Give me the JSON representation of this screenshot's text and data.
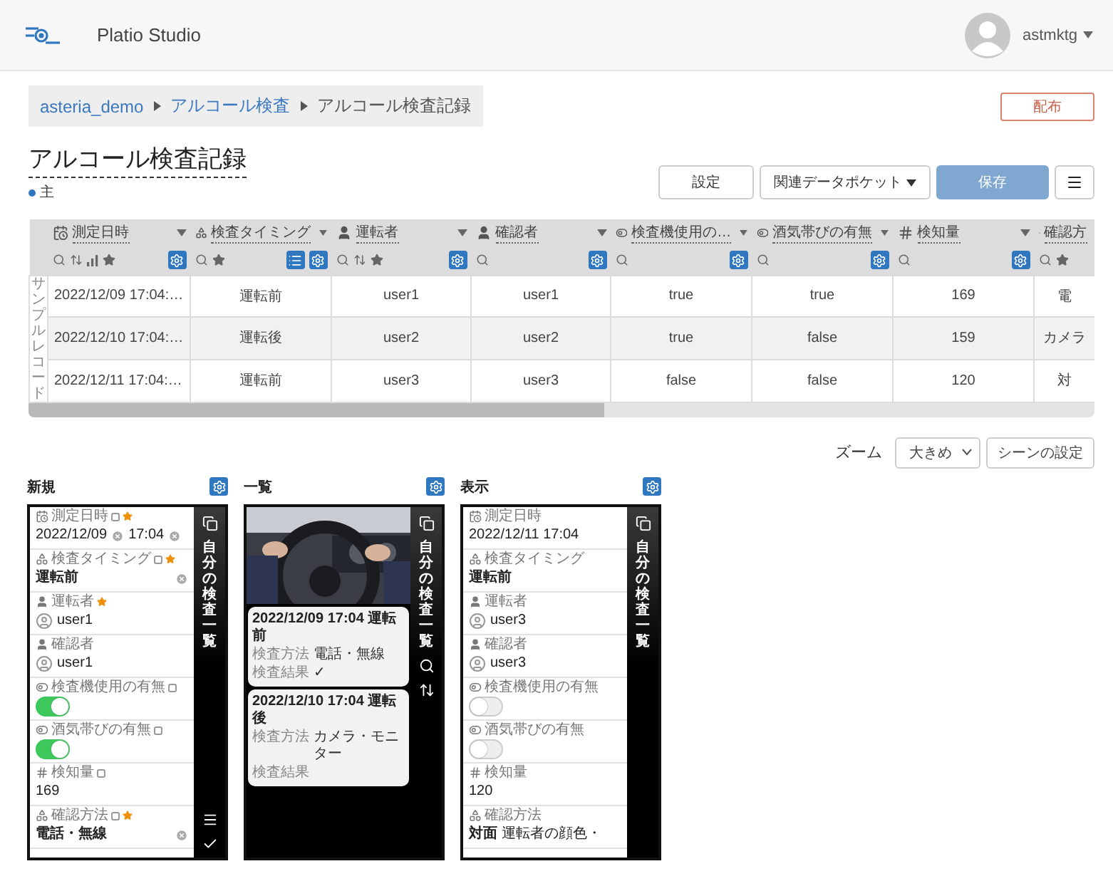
{
  "header": {
    "app_name": "Platio Studio",
    "user": "astmktg"
  },
  "breadcrumb": [
    {
      "label": "asteria_demo",
      "link": true
    },
    {
      "label": "アルコール検査",
      "link": true
    },
    {
      "label": "アルコール検査記録",
      "link": false
    }
  ],
  "publish_button": "配布",
  "page_title": "アルコール検査記録",
  "page_tag": "主",
  "toolbar": [
    {
      "label": "設定",
      "kind": "plain"
    },
    {
      "label": "関連データポケット",
      "kind": "dropdown"
    },
    {
      "label": "保存",
      "kind": "primary"
    },
    {
      "kind": "menu"
    }
  ],
  "table": {
    "side_label": "サンプルレコード",
    "columns": [
      {
        "label": "測定日時",
        "kind": "datetime",
        "sortable": true,
        "chart": true,
        "favorite": true,
        "list_button": false,
        "gear": true
      },
      {
        "label": "検査タイミング",
        "kind": "choice",
        "sortable": false,
        "chart": false,
        "favorite": true,
        "list_button": true,
        "gear": true
      },
      {
        "label": "運転者",
        "kind": "user",
        "sortable": true,
        "chart": false,
        "favorite": true,
        "list_button": false,
        "gear": true
      },
      {
        "label": "確認者",
        "kind": "user",
        "sortable": false,
        "chart": false,
        "favorite": false,
        "list_button": false,
        "gear": true
      },
      {
        "label": "検査機使用の…",
        "kind": "toggle",
        "sortable": false,
        "chart": false,
        "favorite": false,
        "list_button": false,
        "gear": true
      },
      {
        "label": "酒気帯びの有無",
        "kind": "toggle",
        "sortable": false,
        "chart": false,
        "favorite": false,
        "list_button": false,
        "gear": true
      },
      {
        "label": "検知量",
        "kind": "number",
        "sortable": false,
        "chart": false,
        "favorite": false,
        "list_button": false,
        "gear": true
      },
      {
        "label": "確認方",
        "kind": "choice",
        "sortable": false,
        "chart": false,
        "favorite": true,
        "list_button": false,
        "gear": false
      }
    ],
    "rows": [
      [
        "2022/12/09 17:04:…",
        "運転前",
        "user1",
        "user1",
        "true",
        "true",
        "169",
        "電"
      ],
      [
        "2022/12/10 17:04:…",
        "運転後",
        "user2",
        "user2",
        "true",
        "false",
        "159",
        "カメラ"
      ],
      [
        "2022/12/11 17:04:…",
        "運転前",
        "user3",
        "user3",
        "false",
        "false",
        "120",
        "対"
      ]
    ]
  },
  "zoom": {
    "label": "ズーム",
    "value": "大きめ",
    "scene_button": "シーンの設定"
  },
  "screens": [
    {
      "title": "新規",
      "kind": "form",
      "editable": true,
      "sidebar_title": "自分の検査一覧",
      "sidebar": {
        "copy": true,
        "search": false,
        "sort": false,
        "menu": true,
        "check": true
      },
      "fields": [
        {
          "label": "測定日時",
          "kind": "datetime",
          "info": true,
          "required": true,
          "date": "2022/12/09",
          "time": "17:04"
        },
        {
          "label": "検査タイミング",
          "kind": "choice",
          "info": true,
          "required": true,
          "value": "運転前"
        },
        {
          "label": "運転者",
          "kind": "user",
          "info": false,
          "required": true,
          "value": "user1"
        },
        {
          "label": "確認者",
          "kind": "user",
          "info": false,
          "required": false,
          "value": "user1"
        },
        {
          "label": "検査機使用の有無",
          "kind": "toggle",
          "info": true,
          "required": false,
          "on": true
        },
        {
          "label": "酒気帯びの有無",
          "kind": "toggle",
          "info": true,
          "required": false,
          "on": true
        },
        {
          "label": "検知量",
          "kind": "number",
          "info": true,
          "required": false,
          "value": "169"
        },
        {
          "label": "確認方法",
          "kind": "choice",
          "info": true,
          "required": true,
          "value": "電話・無線"
        }
      ]
    },
    {
      "title": "一覧",
      "kind": "list",
      "sidebar_title": "自分の検査一覧",
      "sidebar": {
        "copy": true,
        "search": true,
        "sort": true,
        "menu": false,
        "check": false
      },
      "cards": [
        {
          "title": "2022/12/09 17:04 運転前",
          "rows": [
            {
              "label": "検査方法",
              "value": "電話・無線"
            },
            {
              "label": "検査結果",
              "value": "✓"
            }
          ]
        },
        {
          "title": "2022/12/10 17:04 運転後",
          "rows": [
            {
              "label": "検査方法",
              "value": "カメラ・モニター"
            },
            {
              "label": "検査結果"
            }
          ]
        }
      ]
    },
    {
      "title": "表示",
      "kind": "view",
      "editable": false,
      "sidebar_title": "自分の検査一覧",
      "sidebar": {
        "copy": true,
        "search": false,
        "sort": false,
        "menu": false,
        "check": false
      },
      "fields": [
        {
          "label": "測定日時",
          "kind": "datetime",
          "info": false,
          "required": false,
          "value": "2022/12/11 17:04"
        },
        {
          "label": "検査タイミング",
          "kind": "choice",
          "info": false,
          "required": false,
          "value": "運転前"
        },
        {
          "label": "運転者",
          "kind": "user",
          "info": false,
          "required": false,
          "value": "user3"
        },
        {
          "label": "確認者",
          "kind": "user",
          "info": false,
          "required": false,
          "value": "user3"
        },
        {
          "label": "検査機使用の有無",
          "kind": "toggle",
          "info": false,
          "required": false,
          "on": false
        },
        {
          "label": "酒気帯びの有無",
          "kind": "toggle",
          "info": false,
          "required": false,
          "on": false
        },
        {
          "label": "検知量",
          "kind": "number",
          "info": false,
          "required": false,
          "value": "120"
        },
        {
          "label": "確認方法",
          "kind": "choice",
          "info": false,
          "required": false,
          "value": "対面",
          "detail": "運転者の顔色・"
        }
      ]
    }
  ]
}
